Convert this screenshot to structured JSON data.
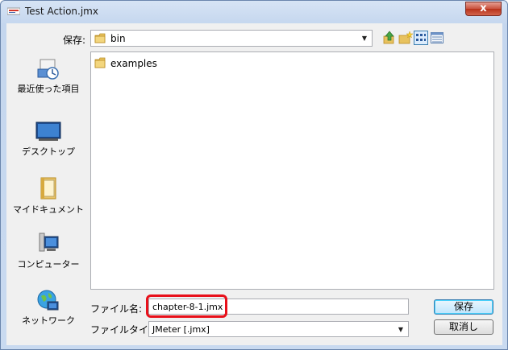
{
  "window": {
    "title": "Test Action.jmx",
    "close_glyph": "x"
  },
  "header": {
    "save_in_label": "保存:",
    "save_in_value": "bin",
    "toolbar_icons": [
      "up-folder-icon",
      "new-folder-icon",
      "view-menu-icon",
      "details-view-icon"
    ]
  },
  "places": [
    {
      "label": "最近使った項目",
      "icon": "recent-items-icon"
    },
    {
      "label": "デスクトップ",
      "icon": "desktop-icon"
    },
    {
      "label": "マイドキュメント",
      "icon": "my-documents-icon"
    },
    {
      "label": "コンピューター",
      "icon": "computer-icon"
    },
    {
      "label": "ネットワーク",
      "icon": "network-icon"
    }
  ],
  "files": [
    {
      "name": "examples",
      "type": "folder"
    }
  ],
  "form": {
    "filename_label": "ファイル名:",
    "filename_value": "chapter-8-1.jmx",
    "filetype_label": "ファイルタイプ:",
    "filetype_value": "JMeter [.jmx]"
  },
  "buttons": {
    "save": "保存",
    "cancel": "取消し"
  },
  "colors": {
    "highlight": "#e8101a",
    "title_bar": "#c4d6ee",
    "dialog_bg": "#f0f0f0"
  }
}
